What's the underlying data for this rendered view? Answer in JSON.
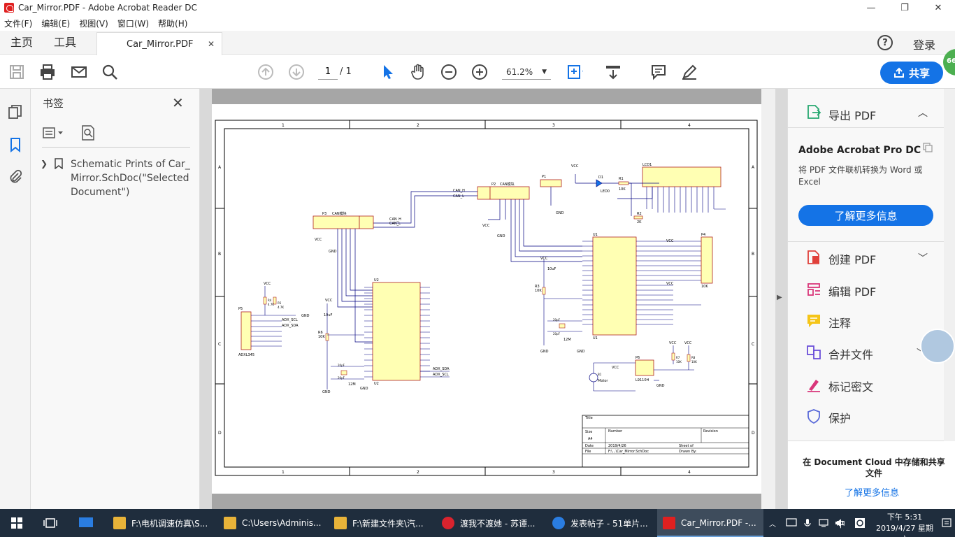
{
  "window": {
    "title": "Car_Mirror.PDF - Adobe Acrobat Reader DC",
    "min": "—",
    "max": "❐",
    "close": "✕"
  },
  "menu": [
    "文件(F)",
    "编辑(E)",
    "视图(V)",
    "窗口(W)",
    "帮助(H)"
  ],
  "tabs": {
    "home": "主页",
    "tools": "工具",
    "document": "Car_Mirror.PDF",
    "close": "✕",
    "help": "?",
    "login": "登录"
  },
  "toolbar": {
    "page_current": "1",
    "page_total": "/ 1",
    "zoom": "61.2%",
    "share": "共享",
    "badge": "66"
  },
  "bookmarks": {
    "title": "书签",
    "items": [
      {
        "label": "Schematic Prints of Car_Mirror.SchDoc(\"Selected Document\")"
      }
    ]
  },
  "schematic": {
    "cols": [
      "1",
      "2",
      "3",
      "4"
    ],
    "rows": [
      "A",
      "B",
      "C",
      "D"
    ],
    "labels": {
      "lcd": "LCD1",
      "led": "LED0",
      "d1": "D1",
      "r1": "R1",
      "r1v": "10K",
      "r2": "R2",
      "r2v": "2K",
      "p1": "P1",
      "p2": "P2",
      "can1": "CAN模块",
      "can_h": "CAN_H",
      "can_l": "CAN_L",
      "p3": "P3",
      "can2": "CAN模块",
      "u1": "U1",
      "u2": "U2",
      "p4": "P4",
      "p5": "P5",
      "adxl": "ADXL345",
      "adx_scl": "ADX_SCL",
      "adx_sda": "ADX_SDA",
      "p6": "P6",
      "l9110": "L9110H",
      "motor": "Motor",
      "b1": "B1",
      "vcc": "VCC",
      "gnd": "GND",
      "r3": "R3",
      "r3v": "10K",
      "r4": "R4",
      "r4v": "4.7K",
      "r5": "R5",
      "r5v": "4.7K",
      "r6": "R6",
      "r6v": "10K",
      "r7": "R7",
      "r7v": "10K",
      "r8": "R8",
      "r8v": "10K",
      "c10uf": "10uF",
      "c20pf": "20pF",
      "xtal": "12M",
      "p4v": "10K",
      "tb_title": "Title",
      "tb_size": "Size",
      "tb_a4": "A4",
      "tb_number": "Number",
      "tb_revision": "Revision",
      "tb_date": "Date",
      "tb_file": "File",
      "tb_dateval": "2019/4/26",
      "tb_fileval": "F:\\...\\Car_Mirror.SchDoc",
      "tb_sheet": "Sheet of",
      "tb_drawn": "Drawn By:"
    }
  },
  "right_panel": {
    "export": "导出 PDF",
    "promo_title": "Adobe Acrobat Pro DC",
    "promo_desc": "将 PDF 文件联机转换为 Word 或 Excel",
    "learn_more": "了解更多信息",
    "tools": [
      {
        "label": "创建 PDF",
        "chevron": true
      },
      {
        "label": "编辑 PDF",
        "chevron": false
      },
      {
        "label": "注释",
        "chevron": false
      },
      {
        "label": "合并文件",
        "chevron": true
      },
      {
        "label": "标记密文",
        "chevron": false
      },
      {
        "label": "保护",
        "chevron": false
      }
    ],
    "cloud_title": "在 Document Cloud 中存储和共享文件",
    "cloud_link": "了解更多信息"
  },
  "taskbar": {
    "items": [
      {
        "label": "F:\\电机调速仿真\\S...",
        "color": "#e8b339"
      },
      {
        "label": "C:\\Users\\Adminis...",
        "color": "#e8b339"
      },
      {
        "label": "F:\\新建文件夹\\汽...",
        "color": "#e8b339"
      },
      {
        "label": "渡我不渡她 - 苏谭...",
        "color": "#d9232e"
      },
      {
        "label": "发表帖子 - 51单片...",
        "color": "#2a7de1"
      },
      {
        "label": "Car_Mirror.PDF -...",
        "color": "#e02020"
      }
    ],
    "ime": "中",
    "time": "下午 5:31",
    "date": "2019/4/27 星期六"
  },
  "colors": {
    "accent": "#1473e6",
    "schematic_wire": "#000080",
    "schematic_part": "#ffffb3",
    "schematic_pin": "#b02020"
  }
}
